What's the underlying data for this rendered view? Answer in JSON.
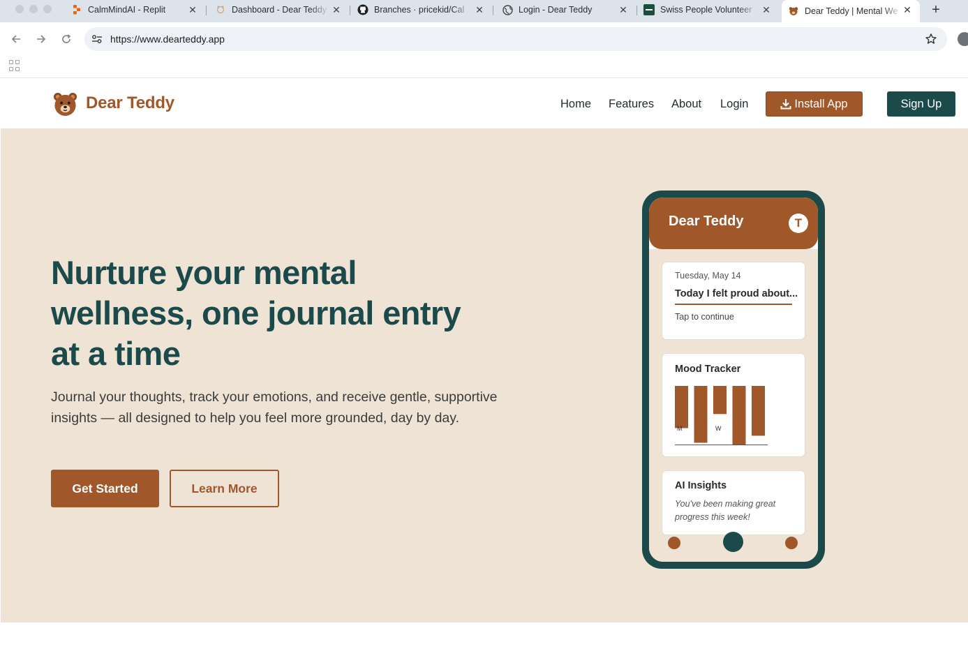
{
  "browser": {
    "tabs": [
      {
        "title": "CalmMindAI - Replit",
        "icon": "replit-icon"
      },
      {
        "title": "Dashboard - Dear Teddy",
        "icon": "teddy-icon"
      },
      {
        "title": "Branches · pricekid/Cal",
        "icon": "github-icon"
      },
      {
        "title": "Login - Dear Teddy",
        "icon": "globe-icon"
      },
      {
        "title": "Swiss People Volunteer",
        "icon": "cspe-icon"
      },
      {
        "title": "Dear Teddy | Mental We",
        "icon": "teddy-icon",
        "active": true
      }
    ],
    "close_glyph": "✕",
    "new_tab_glyph": "+",
    "url": "https://www.dearteddy.app"
  },
  "site": {
    "brand": "Dear Teddy",
    "nav": [
      "Home",
      "Features",
      "About",
      "Login"
    ],
    "install_label": "Install App",
    "signup_label": "Sign Up"
  },
  "hero": {
    "title": "Nurture your mental wellness, one journal entry at a time",
    "subtitle": "Journal your thoughts, track your emotions, and receive gentle, supportive insights — all designed to help you feel more grounded, day by day.",
    "primary_cta": "Get Started",
    "secondary_cta": "Learn More"
  },
  "phone": {
    "app_title": "Dear Teddy",
    "avatar_initial": "T",
    "journal": {
      "date": "Tuesday, May 14",
      "entry": "Today I felt proud about...",
      "hint": "Tap to continue"
    },
    "mood": {
      "title": "Mood Tracker",
      "bars": [
        {
          "label": "M",
          "value": 0.72
        },
        {
          "label": "",
          "value": 0.97
        },
        {
          "label": "W",
          "value": 0.48
        },
        {
          "label": "",
          "value": 1.0
        },
        {
          "label": "",
          "value": 0.85
        }
      ]
    },
    "insights": {
      "title": "AI Insights",
      "text": "You've been making great progress this week!"
    }
  },
  "colors": {
    "brand_brown": "#a0582b",
    "brand_teal": "#1c4a4a",
    "hero_bg": "#efe3d6"
  }
}
